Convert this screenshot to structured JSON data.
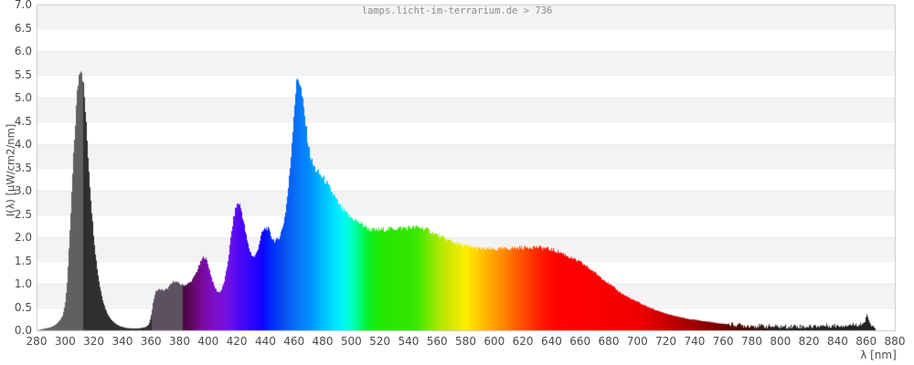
{
  "title": "lamps.licht-im-terrarium.de > 736",
  "chart_data": {
    "type": "area",
    "title": "lamps.licht-im-terrarium.de > 736",
    "xlabel": "λ [nm]",
    "ylabel": "I(λ) [µW/cm2/nm]",
    "xlim": [
      280,
      880
    ],
    "ylim": [
      0,
      7
    ],
    "grid": "horizontal shaded bands every 0.5 units, light gridlines",
    "legend": "none",
    "x_ticks": [
      "280",
      "300",
      "320",
      "340",
      "360",
      "380",
      "400",
      "420",
      "440",
      "460",
      "480",
      "500",
      "520",
      "540",
      "560",
      "580",
      "600",
      "620",
      "640",
      "660",
      "680",
      "700",
      "720",
      "740",
      "760",
      "780",
      "800",
      "820",
      "840",
      "860",
      "880"
    ],
    "y_ticks": [
      "0.0",
      "0.5",
      "1.0",
      "1.5",
      "2.0",
      "2.5",
      "3.0",
      "3.5",
      "4.0",
      "4.5",
      "5.0",
      "5.5",
      "6.0",
      "6.5",
      "7.0"
    ],
    "band_color": "#f4f3f4",
    "gridline_color": "#e9e9e9",
    "border_color": "#c9c9c9",
    "samples": [
      [
        280,
        0.0
      ],
      [
        283,
        0.02
      ],
      [
        286,
        0.04
      ],
      [
        289,
        0.06
      ],
      [
        292,
        0.1
      ],
      [
        294,
        0.15
      ],
      [
        296,
        0.22
      ],
      [
        298,
        0.32
      ],
      [
        299,
        0.45
      ],
      [
        300,
        0.65
      ],
      [
        301,
        1.0
      ],
      [
        302,
        1.5
      ],
      [
        303,
        2.1
      ],
      [
        304,
        2.75
      ],
      [
        305,
        3.4
      ],
      [
        306,
        4.0
      ],
      [
        307,
        4.55
      ],
      [
        308,
        5.05
      ],
      [
        309,
        5.4
      ],
      [
        310,
        5.62
      ],
      [
        310.5,
        5.68
      ],
      [
        311,
        5.65
      ],
      [
        312,
        5.45
      ],
      [
        313,
        5.1
      ],
      [
        314,
        4.65
      ],
      [
        315,
        4.15
      ],
      [
        316,
        3.65
      ],
      [
        317,
        3.15
      ],
      [
        318,
        2.7
      ],
      [
        319,
        2.3
      ],
      [
        320,
        1.95
      ],
      [
        321,
        1.63
      ],
      [
        322,
        1.37
      ],
      [
        323,
        1.15
      ],
      [
        324,
        0.95
      ],
      [
        325,
        0.8
      ],
      [
        326,
        0.66
      ],
      [
        327,
        0.55
      ],
      [
        328,
        0.46
      ],
      [
        329,
        0.38
      ],
      [
        330,
        0.32
      ],
      [
        332,
        0.23
      ],
      [
        334,
        0.17
      ],
      [
        336,
        0.12
      ],
      [
        338,
        0.09
      ],
      [
        340,
        0.07
      ],
      [
        343,
        0.05
      ],
      [
        346,
        0.04
      ],
      [
        350,
        0.04
      ],
      [
        353,
        0.05
      ],
      [
        356,
        0.07
      ],
      [
        358,
        0.12
      ],
      [
        359,
        0.2
      ],
      [
        360,
        0.35
      ],
      [
        361,
        0.55
      ],
      [
        362,
        0.72
      ],
      [
        363,
        0.82
      ],
      [
        364,
        0.86
      ],
      [
        365,
        0.88
      ],
      [
        367,
        0.87
      ],
      [
        369,
        0.86
      ],
      [
        371,
        0.89
      ],
      [
        373,
        0.96
      ],
      [
        375,
        1.04
      ],
      [
        376,
        1.06
      ],
      [
        377,
        1.05
      ],
      [
        379,
        1.01
      ],
      [
        381,
        0.98
      ],
      [
        383,
        0.97
      ],
      [
        385,
        0.99
      ],
      [
        387,
        1.03
      ],
      [
        389,
        1.1
      ],
      [
        391,
        1.22
      ],
      [
        393,
        1.36
      ],
      [
        395,
        1.5
      ],
      [
        396,
        1.56
      ],
      [
        397,
        1.58
      ],
      [
        398,
        1.55
      ],
      [
        399,
        1.48
      ],
      [
        400,
        1.38
      ],
      [
        401,
        1.26
      ],
      [
        402,
        1.14
      ],
      [
        403,
        1.04
      ],
      [
        404,
        0.95
      ],
      [
        405,
        0.89
      ],
      [
        406,
        0.84
      ],
      [
        407,
        0.82
      ],
      [
        408,
        0.83
      ],
      [
        409,
        0.87
      ],
      [
        410,
        0.95
      ],
      [
        411,
        1.06
      ],
      [
        412,
        1.2
      ],
      [
        413,
        1.38
      ],
      [
        414,
        1.6
      ],
      [
        415,
        1.85
      ],
      [
        416,
        2.1
      ],
      [
        417,
        2.32
      ],
      [
        418,
        2.5
      ],
      [
        419,
        2.63
      ],
      [
        420,
        2.71
      ],
      [
        421,
        2.74
      ],
      [
        422,
        2.68
      ],
      [
        423,
        2.57
      ],
      [
        424,
        2.42
      ],
      [
        425,
        2.25
      ],
      [
        426,
        2.08
      ],
      [
        427,
        1.92
      ],
      [
        428,
        1.8
      ],
      [
        429,
        1.7
      ],
      [
        430,
        1.63
      ],
      [
        431,
        1.59
      ],
      [
        432,
        1.58
      ],
      [
        433,
        1.62
      ],
      [
        434,
        1.7
      ],
      [
        435,
        1.82
      ],
      [
        436,
        1.95
      ],
      [
        437,
        2.06
      ],
      [
        438,
        2.13
      ],
      [
        439,
        2.17
      ],
      [
        440,
        2.19
      ],
      [
        441,
        2.2
      ],
      [
        442,
        2.16
      ],
      [
        443,
        2.08
      ],
      [
        444,
        2.0
      ],
      [
        445,
        1.96
      ],
      [
        446,
        1.93
      ],
      [
        447,
        1.92
      ],
      [
        448,
        1.94
      ],
      [
        449,
        1.98
      ],
      [
        450,
        2.05
      ],
      [
        451,
        2.13
      ],
      [
        452,
        2.25
      ],
      [
        453,
        2.4
      ],
      [
        454,
        2.6
      ],
      [
        455,
        2.85
      ],
      [
        456,
        3.15
      ],
      [
        457,
        3.5
      ],
      [
        458,
        3.92
      ],
      [
        459,
        4.38
      ],
      [
        460,
        4.82
      ],
      [
        461,
        5.18
      ],
      [
        462,
        5.4
      ],
      [
        463,
        5.42
      ],
      [
        464,
        5.3
      ],
      [
        465,
        5.1
      ],
      [
        466,
        4.88
      ],
      [
        467,
        4.64
      ],
      [
        468,
        4.4
      ],
      [
        469,
        4.16
      ],
      [
        470,
        3.94
      ],
      [
        471,
        3.78
      ],
      [
        472,
        3.65
      ],
      [
        473,
        3.56
      ],
      [
        474,
        3.5
      ],
      [
        475,
        3.45
      ],
      [
        476,
        3.41
      ],
      [
        477,
        3.38
      ],
      [
        478,
        3.34
      ],
      [
        479,
        3.31
      ],
      [
        480,
        3.28
      ],
      [
        482,
        3.2
      ],
      [
        484,
        3.08
      ],
      [
        486,
        2.98
      ],
      [
        488,
        2.88
      ],
      [
        490,
        2.76
      ],
      [
        492,
        2.66
      ],
      [
        494,
        2.58
      ],
      [
        496,
        2.52
      ],
      [
        498,
        2.46
      ],
      [
        500,
        2.42
      ],
      [
        502,
        2.38
      ],
      [
        504,
        2.34
      ],
      [
        506,
        2.3
      ],
      [
        508,
        2.26
      ],
      [
        510,
        2.22
      ],
      [
        512,
        2.18
      ],
      [
        514,
        2.16
      ],
      [
        516,
        2.15
      ],
      [
        518,
        2.15
      ],
      [
        520,
        2.16
      ],
      [
        523,
        2.17
      ],
      [
        526,
        2.18
      ],
      [
        529,
        2.19
      ],
      [
        532,
        2.19
      ],
      [
        535,
        2.2
      ],
      [
        538,
        2.2
      ],
      [
        541,
        2.21
      ],
      [
        544,
        2.21
      ],
      [
        547,
        2.21
      ],
      [
        550,
        2.2
      ],
      [
        553,
        2.16
      ],
      [
        556,
        2.11
      ],
      [
        559,
        2.06
      ],
      [
        562,
        2.01
      ],
      [
        565,
        1.97
      ],
      [
        568,
        1.93
      ],
      [
        571,
        1.9
      ],
      [
        574,
        1.86
      ],
      [
        577,
        1.83
      ],
      [
        580,
        1.81
      ],
      [
        583,
        1.79
      ],
      [
        586,
        1.77
      ],
      [
        589,
        1.76
      ],
      [
        592,
        1.75
      ],
      [
        595,
        1.74
      ],
      [
        598,
        1.74
      ],
      [
        601,
        1.74
      ],
      [
        604,
        1.75
      ],
      [
        607,
        1.75
      ],
      [
        610,
        1.76
      ],
      [
        613,
        1.77
      ],
      [
        616,
        1.77
      ],
      [
        619,
        1.78
      ],
      [
        622,
        1.78
      ],
      [
        625,
        1.79
      ],
      [
        628,
        1.79
      ],
      [
        631,
        1.78
      ],
      [
        634,
        1.77
      ],
      [
        637,
        1.75
      ],
      [
        640,
        1.73
      ],
      [
        643,
        1.7
      ],
      [
        646,
        1.67
      ],
      [
        649,
        1.63
      ],
      [
        652,
        1.58
      ],
      [
        655,
        1.53
      ],
      [
        658,
        1.49
      ],
      [
        661,
        1.44
      ],
      [
        664,
        1.38
      ],
      [
        667,
        1.31
      ],
      [
        670,
        1.24
      ],
      [
        673,
        1.17
      ],
      [
        676,
        1.1
      ],
      [
        679,
        1.02
      ],
      [
        682,
        0.95
      ],
      [
        685,
        0.88
      ],
      [
        688,
        0.81
      ],
      [
        691,
        0.75
      ],
      [
        694,
        0.7
      ],
      [
        697,
        0.65
      ],
      [
        700,
        0.61
      ],
      [
        703,
        0.56
      ],
      [
        706,
        0.52
      ],
      [
        709,
        0.48
      ],
      [
        712,
        0.44
      ],
      [
        715,
        0.41
      ],
      [
        718,
        0.38
      ],
      [
        721,
        0.35
      ],
      [
        724,
        0.32
      ],
      [
        727,
        0.3
      ],
      [
        730,
        0.28
      ],
      [
        733,
        0.26
      ],
      [
        736,
        0.24
      ],
      [
        739,
        0.23
      ],
      [
        742,
        0.22
      ],
      [
        745,
        0.2
      ],
      [
        748,
        0.19
      ],
      [
        751,
        0.18
      ],
      [
        754,
        0.16
      ],
      [
        757,
        0.15
      ],
      [
        760,
        0.14
      ],
      [
        764,
        0.13
      ],
      [
        768,
        0.12
      ],
      [
        772,
        0.11
      ],
      [
        776,
        0.1
      ],
      [
        780,
        0.1
      ],
      [
        785,
        0.09
      ],
      [
        790,
        0.09
      ],
      [
        795,
        0.08
      ],
      [
        800,
        0.08
      ],
      [
        805,
        0.08
      ],
      [
        810,
        0.09
      ],
      [
        815,
        0.08
      ],
      [
        820,
        0.08
      ],
      [
        825,
        0.09
      ],
      [
        830,
        0.1
      ],
      [
        835,
        0.1
      ],
      [
        840,
        0.1
      ],
      [
        845,
        0.11
      ],
      [
        850,
        0.12
      ],
      [
        854,
        0.13
      ],
      [
        857,
        0.14
      ],
      [
        859,
        0.18
      ],
      [
        860,
        0.35
      ],
      [
        861,
        0.28
      ],
      [
        862,
        0.16
      ],
      [
        863,
        0.12
      ],
      [
        864,
        0.1
      ],
      [
        865,
        0.06
      ],
      [
        866,
        0.02
      ],
      [
        866.5,
        0.0
      ]
    ],
    "color_stops": [
      [
        280,
        "#616061"
      ],
      [
        311,
        "#616061"
      ],
      [
        311.5,
        "#302E30"
      ],
      [
        360,
        "#302E30"
      ],
      [
        360.5,
        "#5C5160"
      ],
      [
        381,
        "#5C5160"
      ],
      [
        381.5,
        "#45063F"
      ],
      [
        386,
        "#560553"
      ],
      [
        390,
        "#670A73"
      ],
      [
        394,
        "#740990"
      ],
      [
        398,
        "#7D0BA8"
      ],
      [
        402,
        "#7E0EBE"
      ],
      [
        406,
        "#7B10CC"
      ],
      [
        409,
        "#7810D8"
      ],
      [
        412,
        "#7611E2"
      ],
      [
        415,
        "#6A0FE8"
      ],
      [
        418,
        "#5E0EEE"
      ],
      [
        421,
        "#5106F4"
      ],
      [
        424,
        "#4506F8"
      ],
      [
        427,
        "#3A05FB"
      ],
      [
        430,
        "#2F04FD"
      ],
      [
        433,
        "#2402FE"
      ],
      [
        436,
        "#1700FF"
      ],
      [
        439,
        "#0B0BFF"
      ],
      [
        442,
        "#0021FE"
      ],
      [
        446,
        "#0034FB"
      ],
      [
        450,
        "#0845F4"
      ],
      [
        454,
        "#0A55F0"
      ],
      [
        458,
        "#0963F2"
      ],
      [
        462,
        "#0972F4"
      ],
      [
        466,
        "#0580F8"
      ],
      [
        470,
        "#008EFC"
      ],
      [
        474,
        "#00A0FE"
      ],
      [
        478,
        "#00B4FF"
      ],
      [
        482,
        "#00C6FF"
      ],
      [
        486,
        "#00D8FF"
      ],
      [
        490,
        "#00E8FF"
      ],
      [
        493,
        "#00F4FB"
      ],
      [
        496,
        "#00FCE4"
      ],
      [
        500,
        "#00FFC0"
      ],
      [
        504,
        "#00FD96"
      ],
      [
        507,
        "#00F866"
      ],
      [
        510,
        "#06F23A"
      ],
      [
        513,
        "#10EE20"
      ],
      [
        517,
        "#1CEB0A"
      ],
      [
        521,
        "#24E900"
      ],
      [
        527,
        "#29E700"
      ],
      [
        534,
        "#2DE700"
      ],
      [
        541,
        "#33E700"
      ],
      [
        547,
        "#44E700"
      ],
      [
        552,
        "#68E800"
      ],
      [
        557,
        "#8FE800"
      ],
      [
        562,
        "#B0E800"
      ],
      [
        567,
        "#C8E800"
      ],
      [
        572,
        "#DEE900"
      ],
      [
        577,
        "#F2EE00"
      ],
      [
        581,
        "#FEED00"
      ],
      [
        585,
        "#FFD800"
      ],
      [
        589,
        "#FFC800"
      ],
      [
        593,
        "#FFB800"
      ],
      [
        597,
        "#FFA800"
      ],
      [
        601,
        "#FF9A00"
      ],
      [
        606,
        "#FF8800"
      ],
      [
        611,
        "#FF7200"
      ],
      [
        616,
        "#FF5C00"
      ],
      [
        621,
        "#FF4800"
      ],
      [
        626,
        "#FF3400"
      ],
      [
        631,
        "#FF2000"
      ],
      [
        637,
        "#FF0E00"
      ],
      [
        644,
        "#FF0200"
      ],
      [
        660,
        "#FE0000"
      ],
      [
        700,
        "#F20000"
      ],
      [
        712,
        "#DA0000"
      ],
      [
        724,
        "#BE0000"
      ],
      [
        736,
        "#A40000"
      ],
      [
        748,
        "#8C0000"
      ],
      [
        760,
        "#700200"
      ],
      [
        770,
        "#550804"
      ],
      [
        780,
        "#3C0D08"
      ],
      [
        790,
        "#2B1A16"
      ],
      [
        800,
        "#232021"
      ],
      [
        868,
        "#232021"
      ]
    ]
  }
}
